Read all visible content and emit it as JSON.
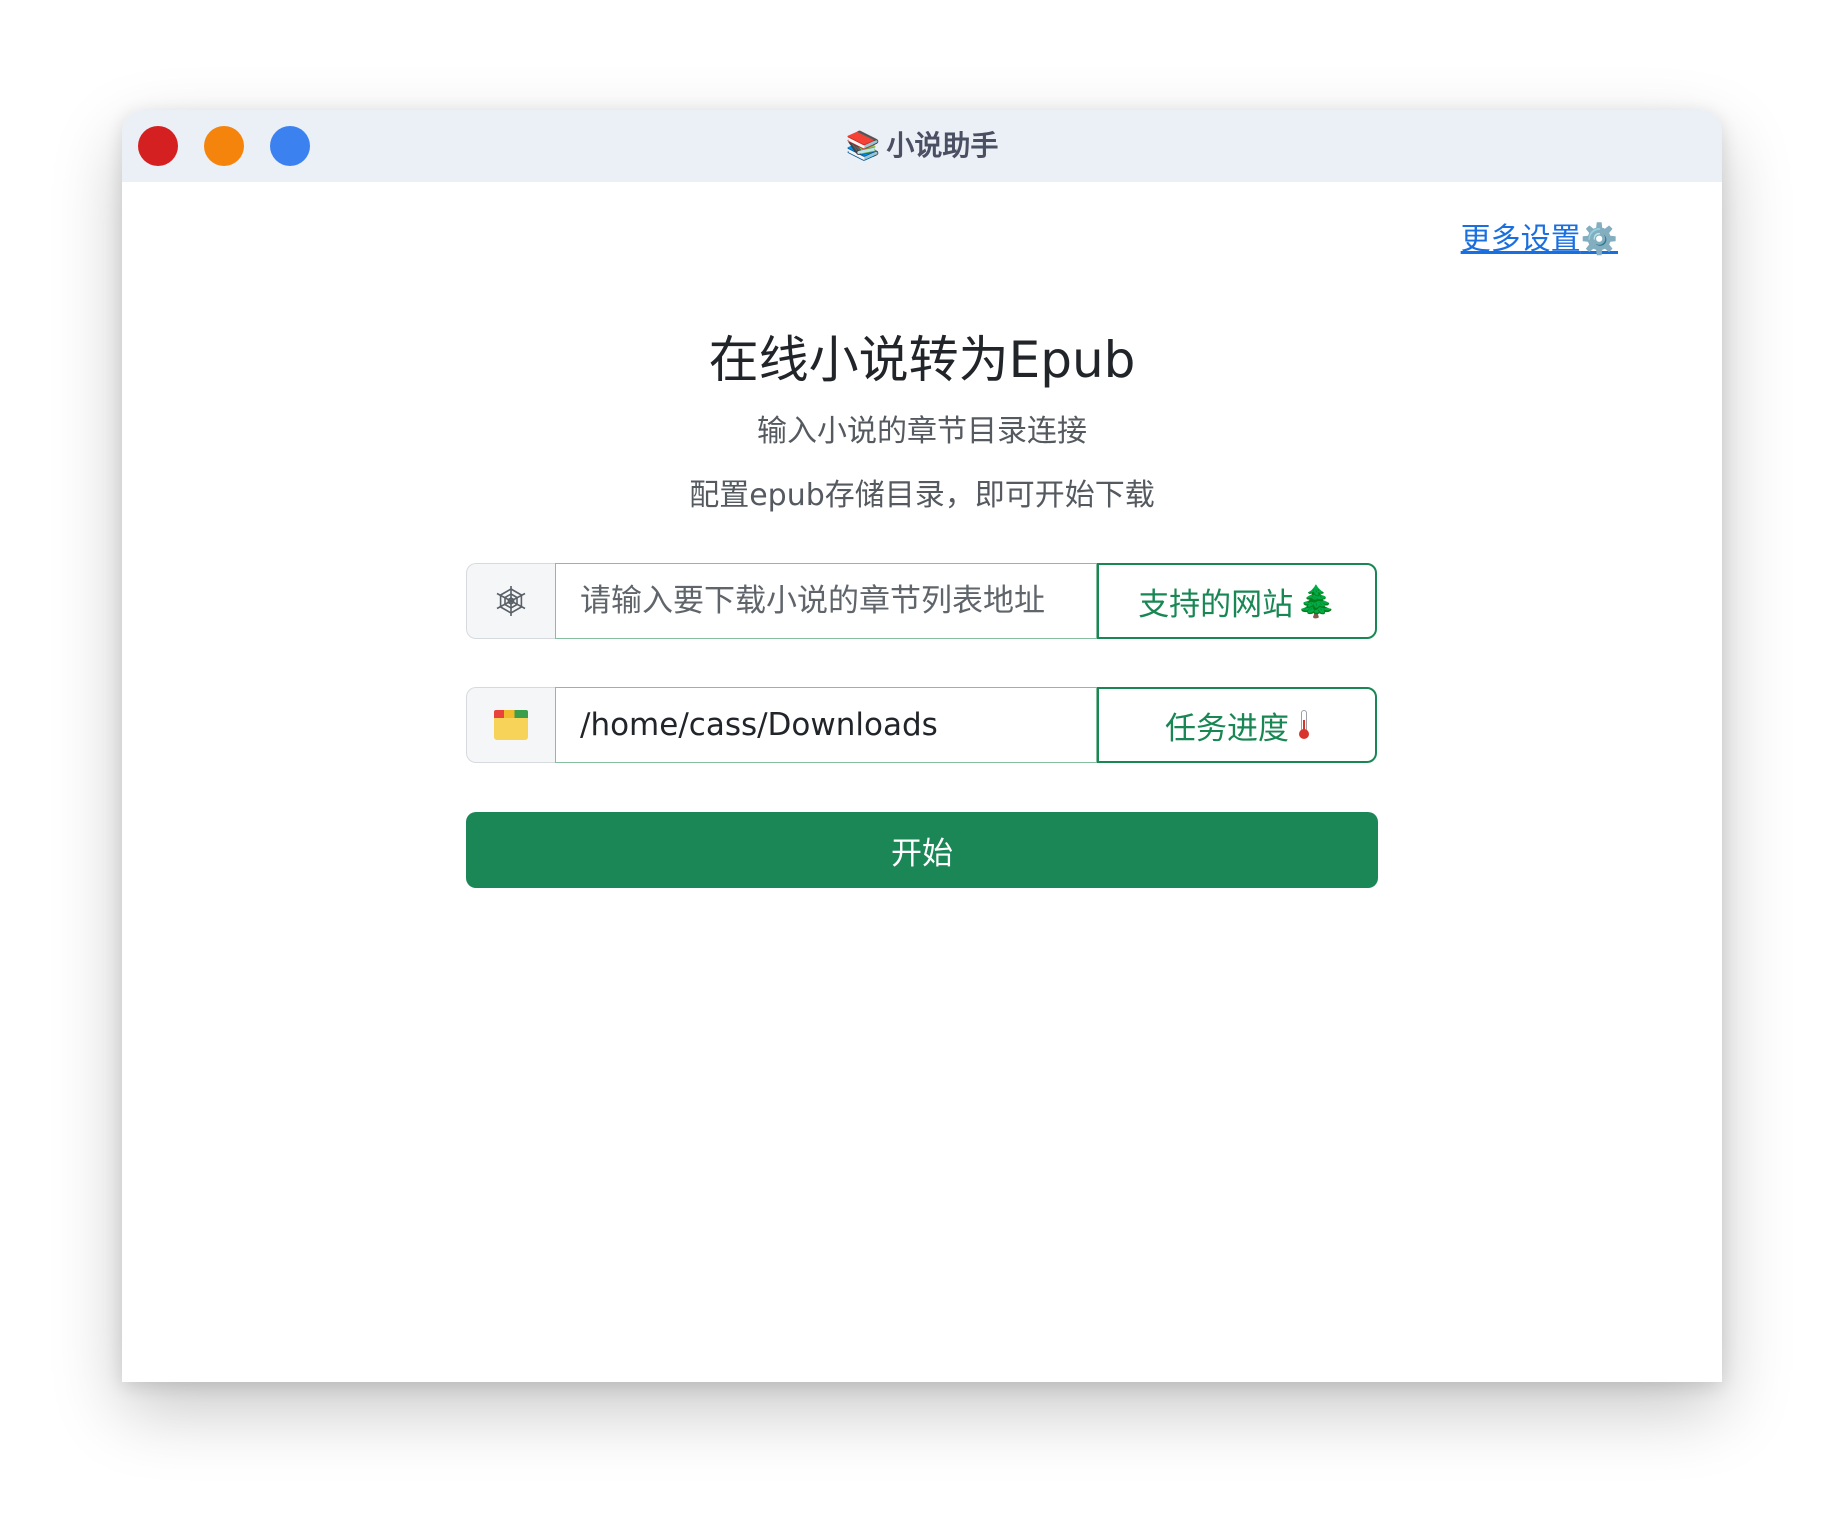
{
  "window": {
    "title": "小说助手",
    "title_icon": "books-icon",
    "controls": {
      "close_color": "#d42020",
      "minimize_color": "#f5840c",
      "maximize_color": "#3b82f0"
    }
  },
  "header": {
    "settings_link": "更多设置",
    "settings_icon": "⚙️"
  },
  "main": {
    "heading": "在线小说转为Epub",
    "subtitle_1": "输入小说的章节目录连接",
    "subtitle_2": "配置epub存储目录，即可开始下载",
    "url_input": {
      "placeholder": "请输入要下载小说的章节列表地址",
      "value": "",
      "prefix_icon": "spider-web-icon",
      "button_label": "支持的网站",
      "button_icon": "🌲"
    },
    "dir_input": {
      "value": "/home/cass/Downloads",
      "prefix_icon": "folder-icon",
      "button_label": "任务进度",
      "button_icon": "thermometer-icon"
    },
    "start_button": "开始"
  },
  "colors": {
    "accent": "#198754",
    "link": "#1a6fe0",
    "titlebar": "#ebeff6"
  }
}
